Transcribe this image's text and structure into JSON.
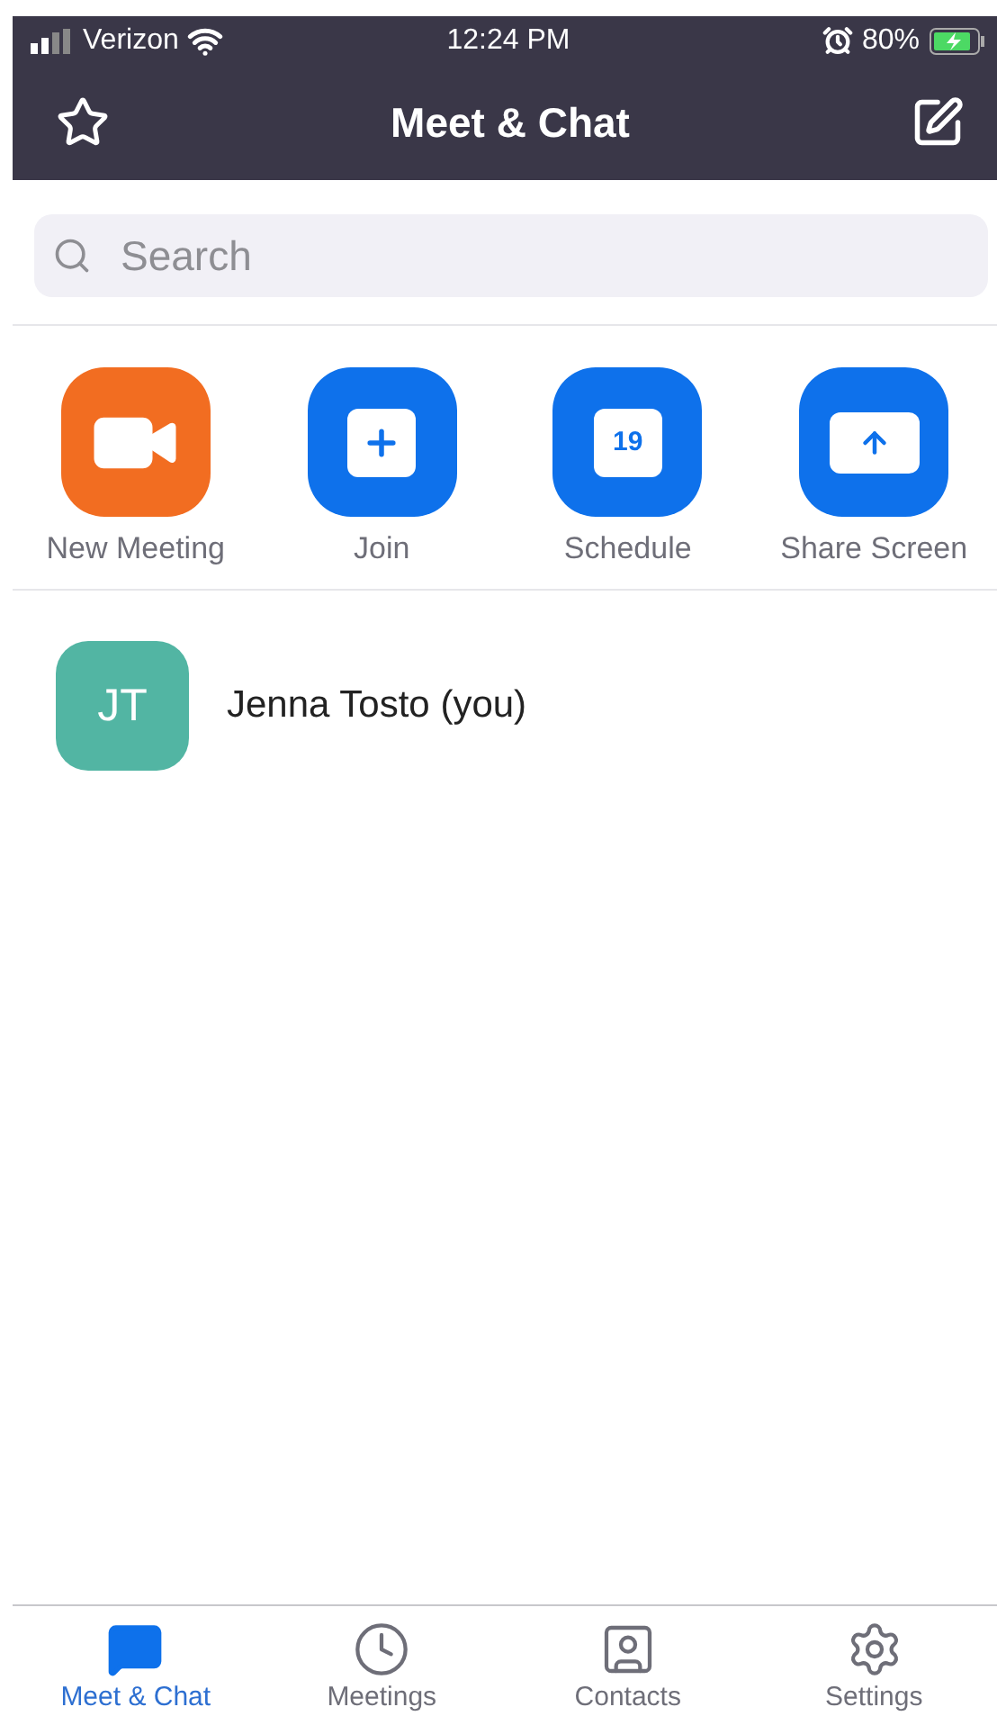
{
  "status_bar": {
    "carrier": "Verizon",
    "time": "12:24 PM",
    "battery": "80%"
  },
  "nav": {
    "title": "Meet & Chat"
  },
  "search": {
    "placeholder": "Search"
  },
  "actions": [
    {
      "kind": "video",
      "label": "New Meeting",
      "color": "#f26d21"
    },
    {
      "kind": "plus",
      "label": "Join",
      "color": "#0e71eb"
    },
    {
      "kind": "calendar",
      "label": "Schedule",
      "color": "#0e71eb",
      "day": "19"
    },
    {
      "kind": "share",
      "label": "Share Screen",
      "color": "#0e71eb"
    }
  ],
  "contacts": [
    {
      "initials": "JT",
      "name": "Jenna Tosto (you)",
      "color": "#52b5a3"
    }
  ],
  "tabs": [
    {
      "kind": "chat",
      "label": "Meet & Chat",
      "selected": true
    },
    {
      "kind": "clock",
      "label": "Meetings",
      "selected": false
    },
    {
      "kind": "contact",
      "label": "Contacts",
      "selected": false
    },
    {
      "kind": "gear",
      "label": "Settings",
      "selected": false
    }
  ]
}
